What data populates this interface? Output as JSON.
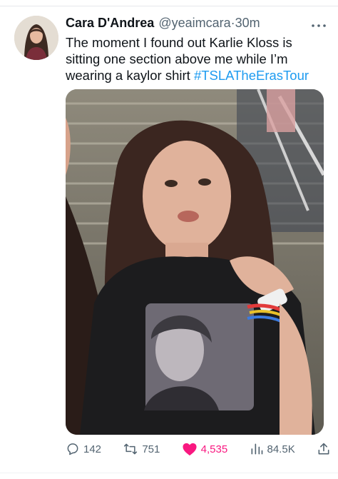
{
  "tweet": {
    "author_name": "Cara D'Andrea",
    "handle": "@yeaimcara",
    "separator": "·",
    "time": "30m",
    "text": "The moment I found out Karlie Kloss is sitting one section above me while I’m wearing a kaylor shirt ",
    "hashtag": "#TSLATheErasTour"
  },
  "icons": {
    "more": "more-horizontal-icon",
    "reply": "reply-icon",
    "retweet": "retweet-icon",
    "like": "heart-icon",
    "views": "views-icon",
    "share": "share-icon"
  },
  "actions": {
    "replies": "142",
    "retweets": "751",
    "likes": "4,535",
    "views": "84.5K"
  },
  "colors": {
    "text": "#0f1419",
    "secondary": "#536471",
    "link": "#1d9bf0",
    "like": "#f91880"
  }
}
